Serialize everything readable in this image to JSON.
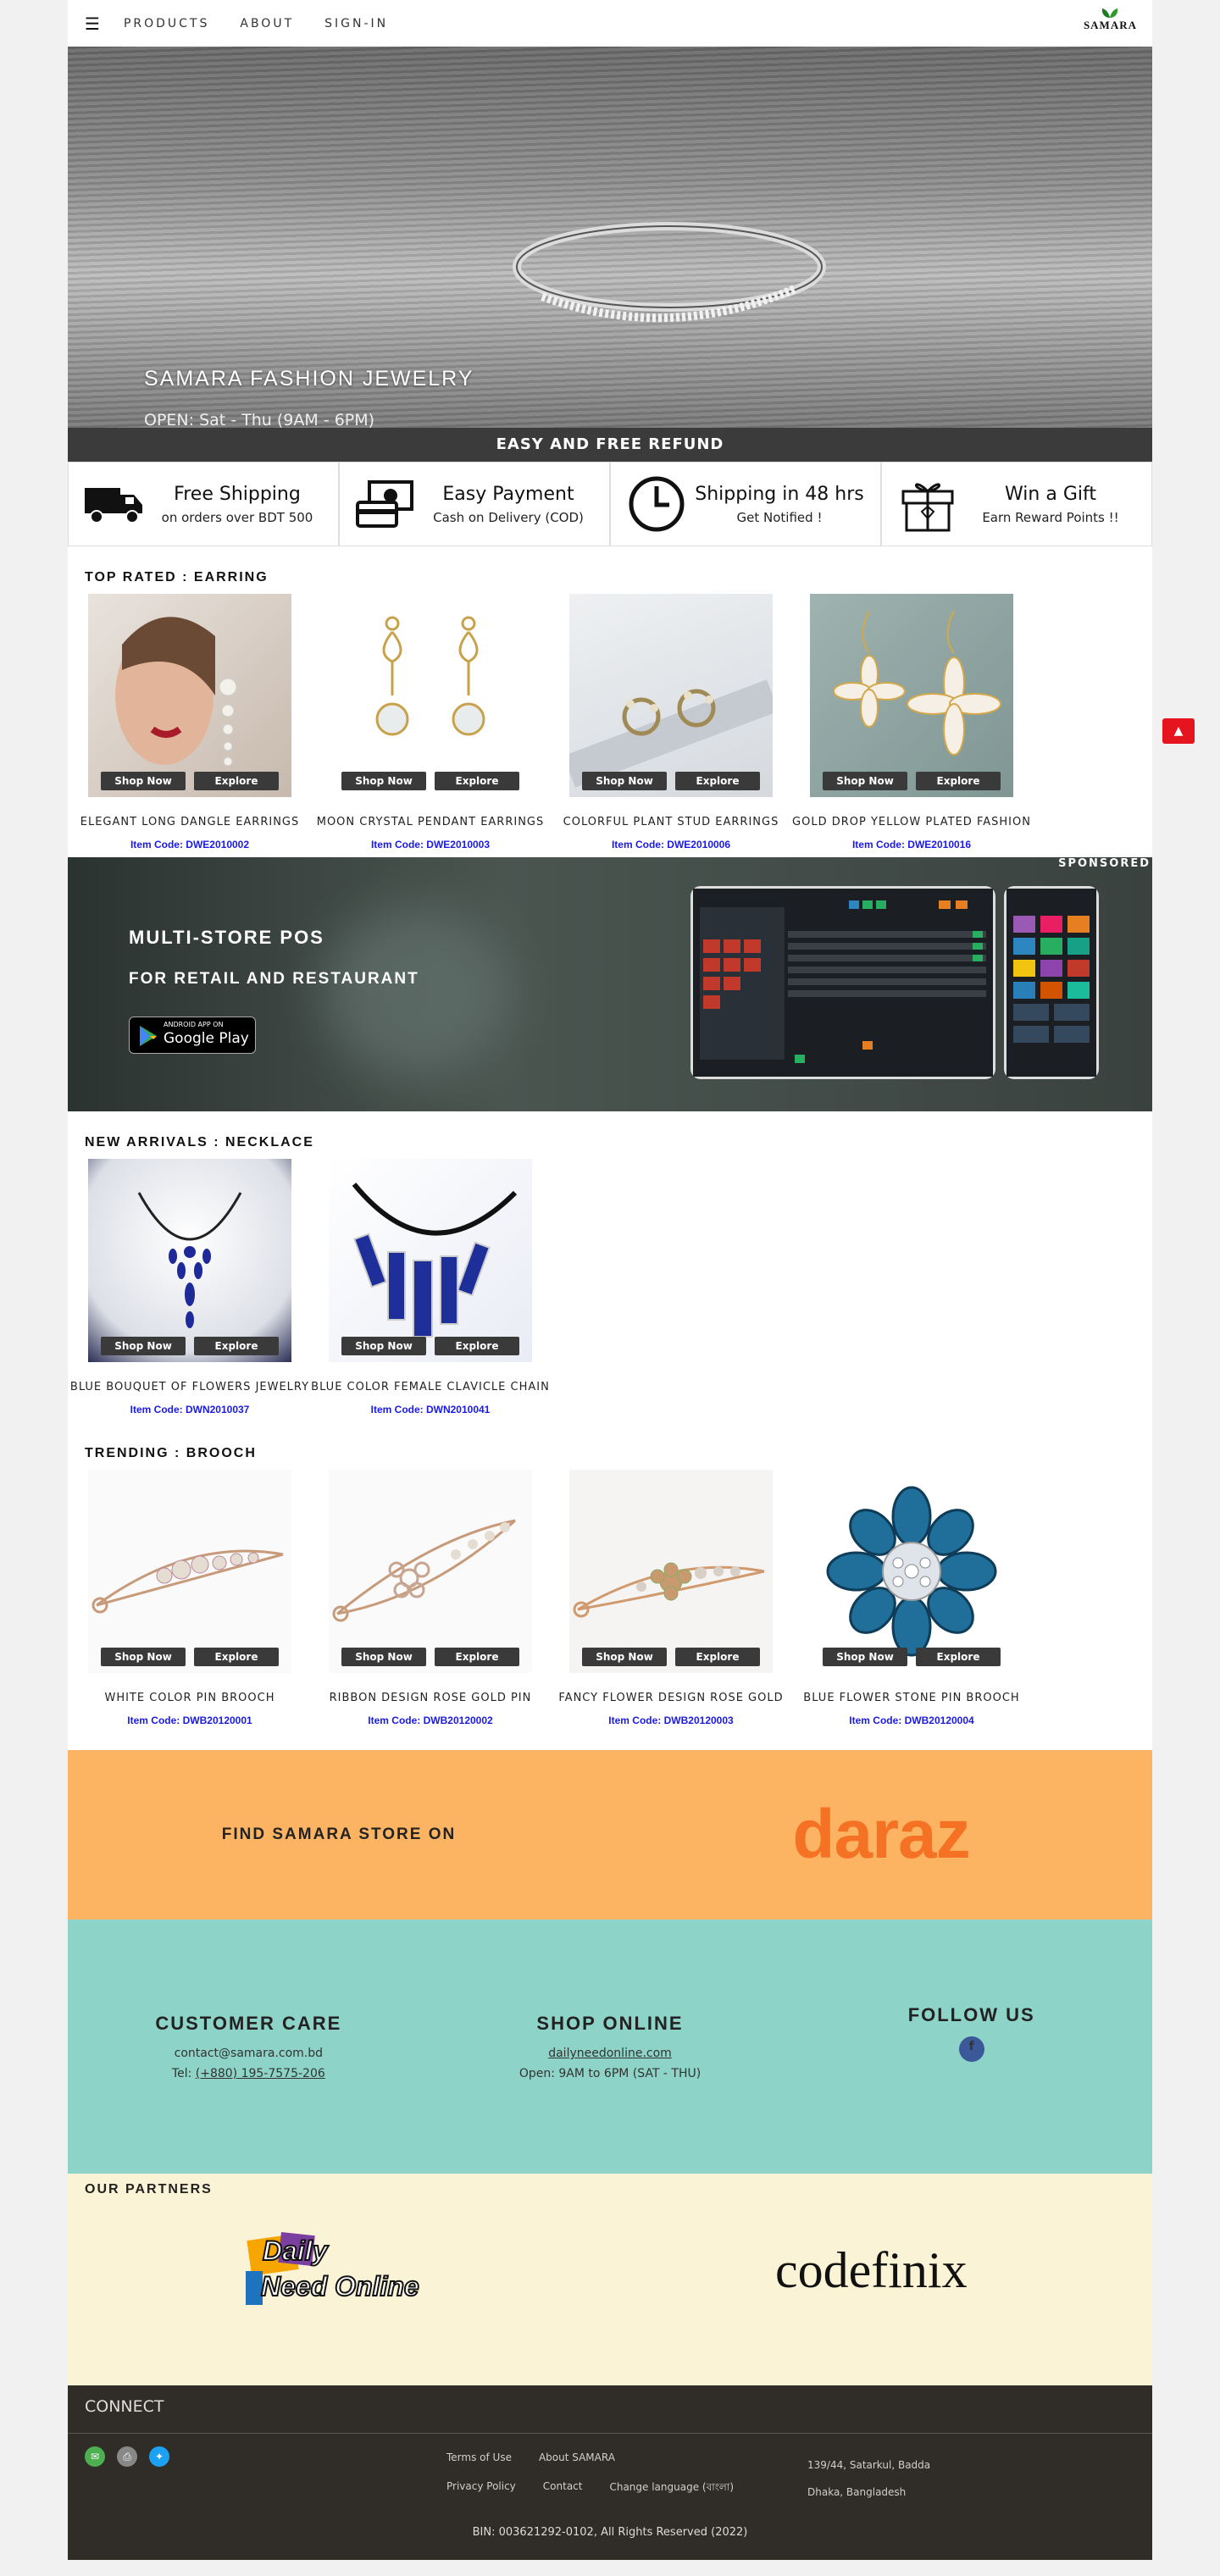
{
  "nav": {
    "items": [
      "PRODUCTS",
      "ABOUT",
      "SIGN-IN"
    ],
    "logo_text": "SAMARA"
  },
  "hero": {
    "title": "SAMARA FASHION JEWELRY",
    "hours": "OPEN: Sat - Thu (9AM - 6PM)"
  },
  "refund_bar": "EASY AND FREE REFUND",
  "features": [
    {
      "title": "Free Shipping",
      "sub": "on orders over BDT 500",
      "icon": "truck-icon"
    },
    {
      "title": "Easy Payment",
      "sub": "Cash on Delivery (COD)",
      "icon": "cash-icon"
    },
    {
      "title": "Shipping in 48 hrs",
      "sub": "Get Notified !",
      "icon": "clock-icon"
    },
    {
      "title": "Win a Gift",
      "sub": "Earn Reward Points !!",
      "icon": "gift-icon"
    }
  ],
  "buttons": {
    "shop": "Shop Now",
    "explore": "Explore"
  },
  "earring": {
    "heading": "TOP RATED : EARRING",
    "items": [
      {
        "name": "ELEGANT LONG DANGLE EARRINGS",
        "code": "Item Code: DWE2010002"
      },
      {
        "name": "MOON CRYSTAL PENDANT EARRINGS",
        "code": "Item Code: DWE2010003"
      },
      {
        "name": "COLORFUL PLANT STUD EARRINGS",
        "code": "Item Code: DWE2010006"
      },
      {
        "name": "GOLD DROP YELLOW PLATED FASHION",
        "code": "Item Code: DWE2010016"
      }
    ]
  },
  "sponsored": {
    "tag": "SPONSORED",
    "title": "MULTI-STORE POS",
    "subtitle": "FOR RETAIL AND RESTAURANT",
    "badge_small": "ANDROID APP ON",
    "badge_big": "Google Play"
  },
  "necklace": {
    "heading": "NEW ARRIVALS : NECKLACE",
    "items": [
      {
        "name": "BLUE BOUQUET OF FLOWERS JEWELRY",
        "code": "Item Code: DWN2010037"
      },
      {
        "name": "BLUE COLOR FEMALE CLAVICLE CHAIN",
        "code": "Item Code: DWN2010041"
      }
    ]
  },
  "brooch": {
    "heading": "TRENDING : BROOCH",
    "items": [
      {
        "name": "WHITE COLOR PIN BROOCH",
        "code": "Item Code: DWB20120001"
      },
      {
        "name": "RIBBON DESIGN ROSE GOLD PIN",
        "code": "Item Code: DWB20120002"
      },
      {
        "name": "FANCY FLOWER DESIGN ROSE GOLD",
        "code": "Item Code: DWB20120003"
      },
      {
        "name": "BLUE FLOWER STONE PIN BROOCH",
        "code": "Item Code: DWB20120004"
      }
    ]
  },
  "daraz": {
    "label": "FIND SAMARA STORE ON",
    "brand": "daraz"
  },
  "contact": {
    "care": {
      "title": "CUSTOMER CARE",
      "email": "contact@samara.com.bd",
      "tel_prefix": "Tel: ",
      "tel": "(+880) 195-7575-206"
    },
    "shop": {
      "title": "SHOP ONLINE",
      "url": "dailyneedonline.com",
      "hours": "Open: 9AM to 6PM (SAT - THU)"
    },
    "follow": {
      "title": "FOLLOW US"
    }
  },
  "partners": {
    "heading": "OUR PARTNERS",
    "p1a": "Daily",
    "p1b": "Need Online",
    "p2": "codefinix"
  },
  "footer": {
    "connect": "CONNECT",
    "links_row1": [
      "Terms of Use",
      "About SAMARA"
    ],
    "links_row2": [
      "Privacy Policy",
      "Contact",
      "Change language (বাংলা)"
    ],
    "addr1": "139/44, Satarkul, Badda",
    "addr2": "Dhaka, Bangladesh",
    "bin": "BIN: 003621292-0102, All Rights Reserved (2022)"
  },
  "colors": {
    "accent_blue": "#1a1ae6",
    "to_top_red": "#e6141f",
    "daraz_bg": "#fdb462",
    "contact_bg": "#8dd3c7",
    "partners_bg": "#fbf3d5",
    "footer_bg": "#302c27"
  }
}
